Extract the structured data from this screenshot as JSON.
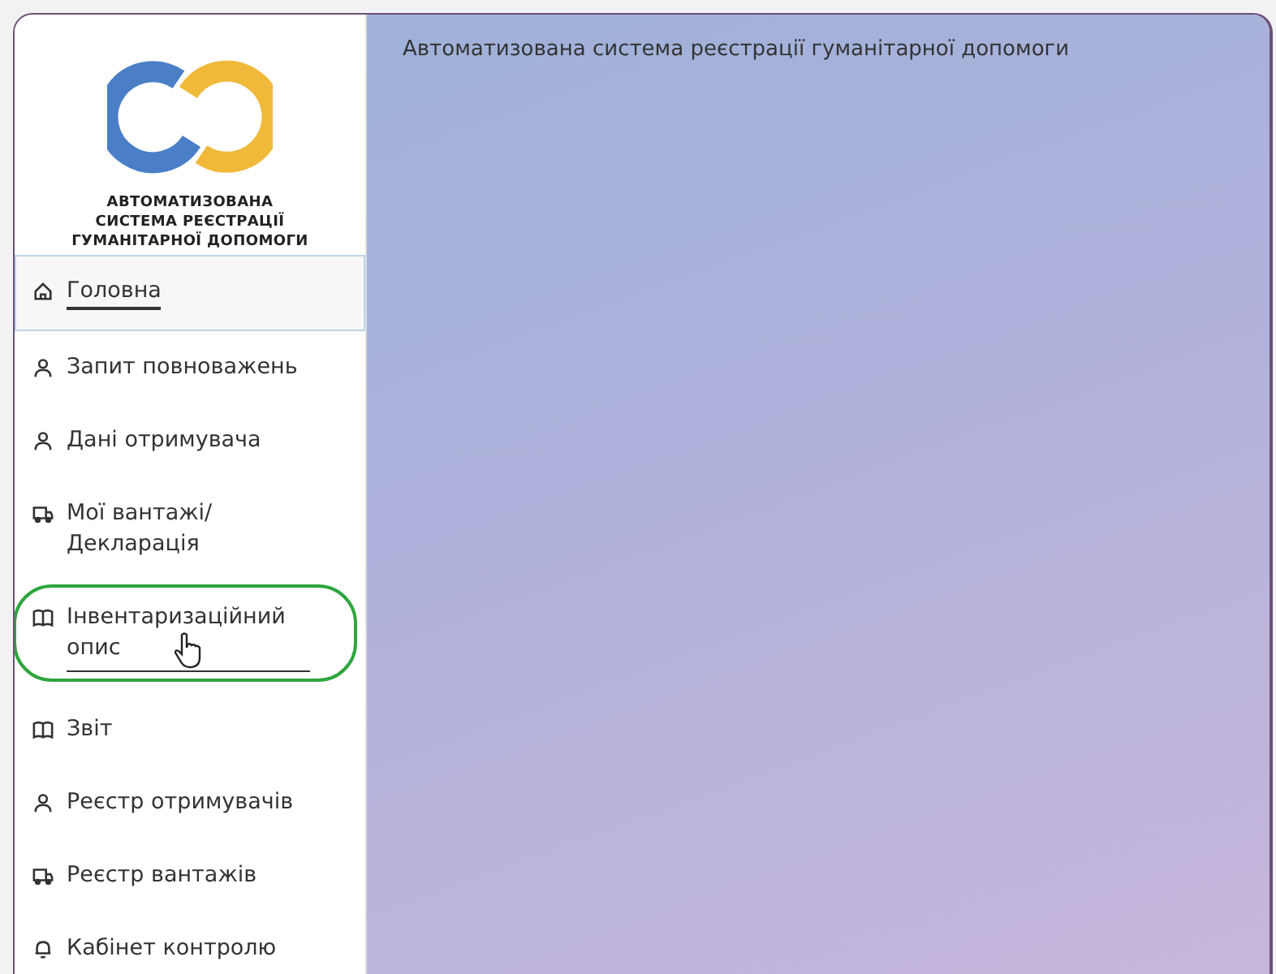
{
  "logo": {
    "lines": [
      "АВТОМАТИЗОВАНА",
      "СИСТЕМА РЕЄСТРАЦІЇ",
      "ГУМАНІТАРНОЇ ДОПОМОГИ"
    ]
  },
  "header": {
    "title": "Автоматизована система реєстрації гуманітарної допомоги"
  },
  "sidebar": {
    "items": [
      {
        "label": "Головна",
        "kind": "home",
        "selected": true,
        "hovered": false
      },
      {
        "label": "Запит повноважень",
        "kind": "person",
        "selected": false,
        "hovered": false
      },
      {
        "label": "Дані отримувача",
        "kind": "person",
        "selected": false,
        "hovered": false
      },
      {
        "label": "Мої вантажі/ Декларація",
        "kind": "truck",
        "selected": false,
        "hovered": false
      },
      {
        "label": "Інвентаризаційний опис",
        "kind": "book",
        "selected": false,
        "hovered": true
      },
      {
        "label": "Звіт",
        "kind": "book",
        "selected": false,
        "hovered": false
      },
      {
        "label": "Реєстр отримувачів",
        "kind": "person",
        "selected": false,
        "hovered": false
      },
      {
        "label": "Реєстр вантажів",
        "kind": "truck",
        "selected": false,
        "hovered": false
      },
      {
        "label": "Кабінет контролю",
        "kind": "bell",
        "selected": false,
        "hovered": false
      }
    ]
  }
}
